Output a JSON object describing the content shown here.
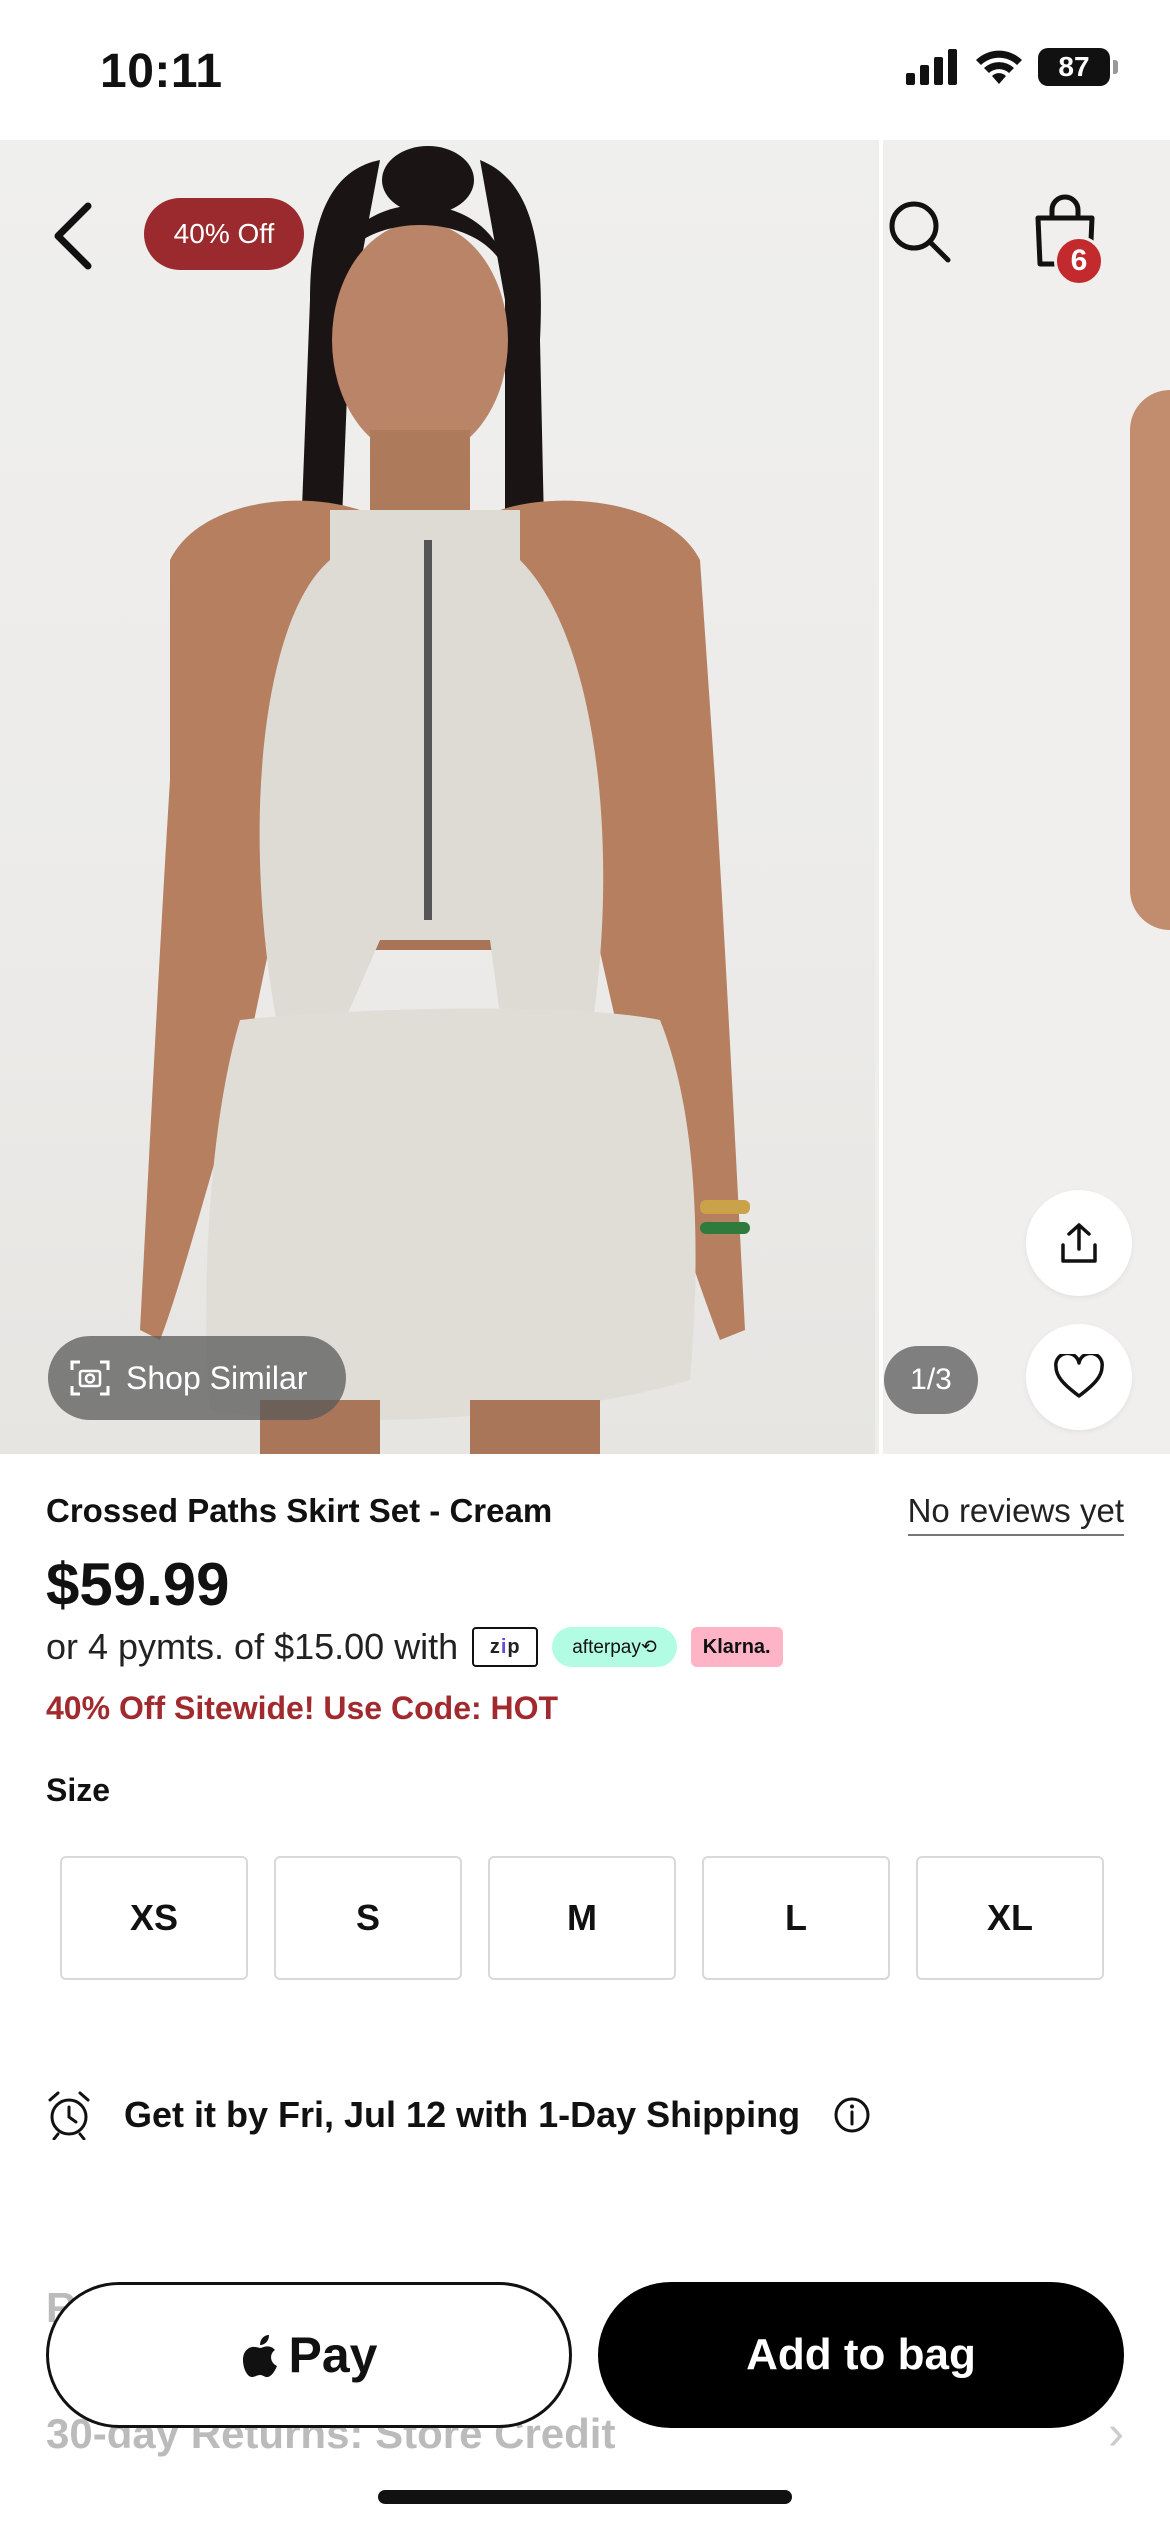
{
  "status_bar": {
    "time": "10:11",
    "battery": "87"
  },
  "hero": {
    "discount_badge": "40% Off",
    "bag_count": "6",
    "page_indicator": "1/3",
    "shop_similar_label": "Shop Similar"
  },
  "product": {
    "title": "Crossed Paths Skirt Set - Cream",
    "reviews": "No reviews yet",
    "price": "$59.99",
    "installments_text": "or 4 pymts. of $15.00 with",
    "payment_providers": [
      "zip",
      "afterpay",
      "Klarna."
    ],
    "promo": "40% Off Sitewide! Use Code: HOT"
  },
  "size": {
    "label": "Size",
    "options": [
      "XS",
      "S",
      "M",
      "L",
      "XL"
    ]
  },
  "delivery": {
    "text": "Get it by Fri, Jul 12 with 1-Day Shipping"
  },
  "sections": {
    "returns": "30-day Returns: Store Credit",
    "partial_letter": "R"
  },
  "actions": {
    "apple_pay_label": "Pay",
    "add_to_bag_label": "Add to bag"
  },
  "colors": {
    "accent_red": "#9b2a2e",
    "badge_red": "#c22a2e",
    "afterpay_mint": "#b2fce4",
    "klarna_pink": "#ffb3c7"
  }
}
